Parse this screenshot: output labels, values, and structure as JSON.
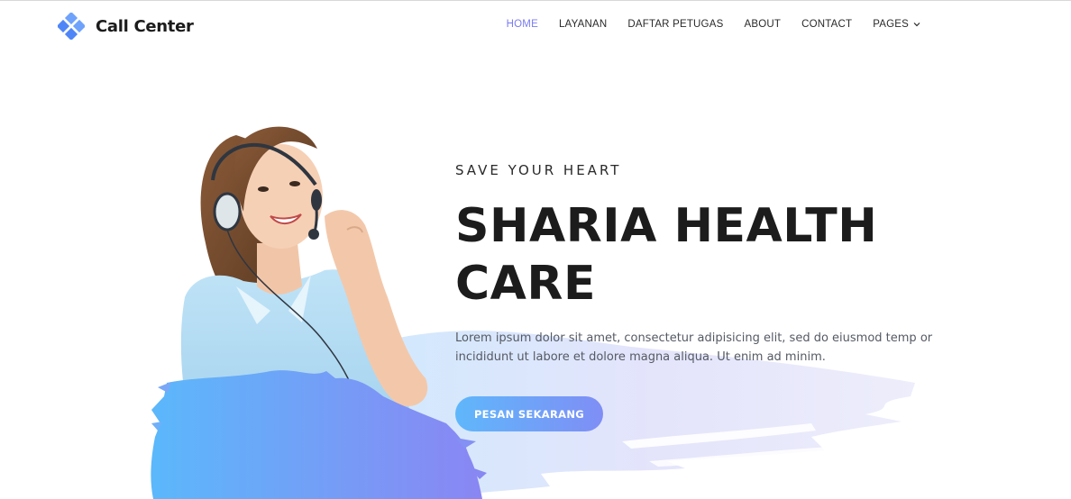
{
  "brand": {
    "name": "Call Center",
    "logo_icon": "diamond-cluster-icon",
    "logo_color": "#5b8ff9"
  },
  "nav": {
    "items": [
      {
        "label": "HOME",
        "active": true
      },
      {
        "label": "LAYANAN",
        "active": false
      },
      {
        "label": "DAFTAR PETUGAS",
        "active": false
      },
      {
        "label": "ABOUT",
        "active": false
      },
      {
        "label": "CONTACT",
        "active": false
      },
      {
        "label": "PAGES",
        "active": false,
        "dropdown_icon": "chevron-down-icon"
      }
    ],
    "active_color": "#7a7bf0"
  },
  "hero": {
    "eyebrow": "SAVE YOUR HEART",
    "title_line1": "SHARIA HEALTH",
    "title_line2": "CARE",
    "description": "Lorem ipsum dolor sit amet, consectetur adipisicing elit, sed do eiusmod temp or incididunt ut labore et dolore magna aliqua. Ut enim ad minim.",
    "cta_label": "PESAN SEKARANG",
    "image": "call-center-agent-with-headset",
    "gradient_colors": [
      "#5fb7fb",
      "#7f8ef5"
    ]
  }
}
